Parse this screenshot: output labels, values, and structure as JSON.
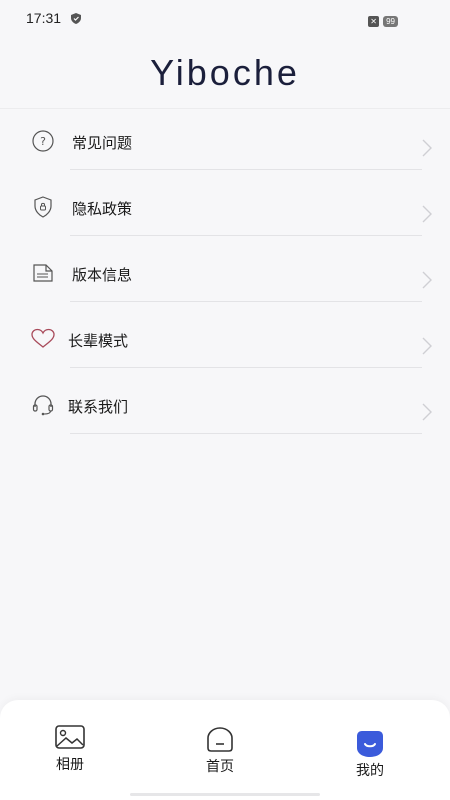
{
  "status": {
    "time": "17:31",
    "notif_badge": "✕",
    "battery": "99"
  },
  "logo": {
    "text": "Yiboche"
  },
  "menu": {
    "items": [
      {
        "label": "常见问题",
        "icon": "question-circle-icon"
      },
      {
        "label": "隐私政策",
        "icon": "shield-lock-icon"
      },
      {
        "label": "版本信息",
        "icon": "document-icon"
      },
      {
        "label": "长辈模式",
        "icon": "heart-icon"
      },
      {
        "label": "联系我们",
        "icon": "headset-icon"
      }
    ]
  },
  "tabbar": {
    "tabs": [
      {
        "label": "相册",
        "icon": "album-icon"
      },
      {
        "label": "首页",
        "icon": "home-icon"
      },
      {
        "label": "我的",
        "icon": "profile-icon",
        "active": true
      }
    ],
    "accent": "#3b5bdb"
  }
}
